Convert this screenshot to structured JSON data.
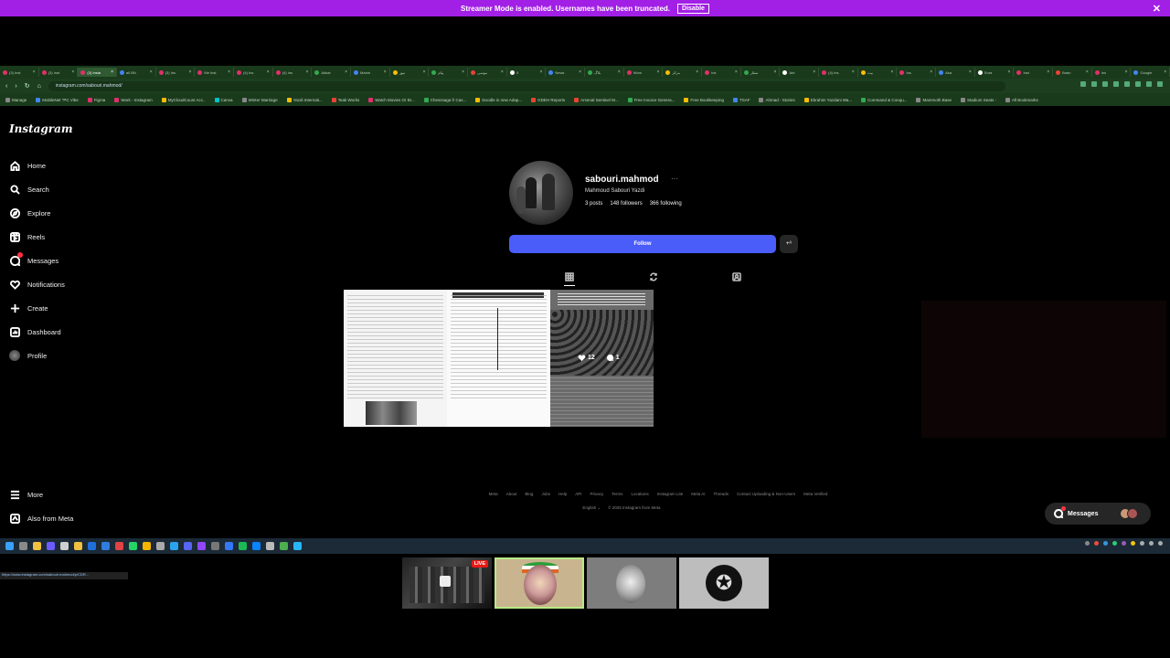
{
  "streamer": {
    "message": "Streamer Mode is enabled. Usernames have been truncated.",
    "disable_label": "Disable",
    "close_glyph": "✕"
  },
  "browser": {
    "tabs": [
      "(3) Inst",
      "(3) Inst",
      "(3) Insta",
      "all BN",
      "(3) Ins",
      "Me Inst",
      "(4) Ins",
      "(4) Ins",
      "Akbar",
      "Mahm",
      "نیوز",
      "پیام",
      "موسی",
      "X",
      "News",
      "بلاگ",
      "Wom",
      "مرکز",
      "Ins",
      "سقار",
      "Ant",
      "(4) Ins",
      "بیت",
      "Ins",
      "Aka",
      "Sora",
      "Inst",
      "Brain",
      "Ins",
      "Google"
    ],
    "url": "instagram.com/sabouri.mahmod/",
    "bookmarks": [
      "Manage",
      "MobileNet \"PC Vibe",
      "Figma",
      "Work - Instagram",
      "MyCloudCount Acc..",
      "Canva",
      "Winter Marriage",
      "Yazdi Internati...",
      "Teak Works",
      "Watch Movies Or Br...",
      "Chesssaga fr Cas...",
      "Doodle in new Adap...",
      "GDEH Reports",
      "Arsenal Sentinel M...",
      "Free Invoice Genera...",
      "Free Bookkeeping",
      "TSAF",
      "Ahmad - Stories",
      "Ebrahim Yazdani Wa...",
      "Command & Conqu...",
      "Mammoth Base",
      "Stadium Seats -",
      "All Bookmarks"
    ]
  },
  "instagram": {
    "logo": "Instagram",
    "nav": [
      {
        "label": "Home",
        "icon": "home-icon"
      },
      {
        "label": "Search",
        "icon": "search-icon"
      },
      {
        "label": "Explore",
        "icon": "compass-icon"
      },
      {
        "label": "Reels",
        "icon": "reels-icon"
      },
      {
        "label": "Messages",
        "icon": "messenger-icon"
      },
      {
        "label": "Notifications",
        "icon": "heart-icon"
      },
      {
        "label": "Create",
        "icon": "plus-icon"
      },
      {
        "label": "Dashboard",
        "icon": "dashboard-icon"
      },
      {
        "label": "Profile",
        "icon": "avatar-icon"
      }
    ],
    "more_label": "More",
    "also_meta_label": "Also from Meta",
    "profile": {
      "username": "sabouri.mahmod",
      "more_dots": "···",
      "full_name": "Mahmoud Sabouri Yazdi",
      "posts": "3 posts",
      "followers": "148 followers",
      "following": "366 following",
      "follow_label": "Follow",
      "suggest_label": "+ᴬ"
    },
    "posts": [
      {
        "likes": "",
        "comments": ""
      },
      {
        "likes": "",
        "comments": ""
      },
      {
        "likes": "12",
        "comments": "1"
      }
    ],
    "footer_links": [
      "Meta",
      "About",
      "Blog",
      "Jobs",
      "Help",
      "API",
      "Privacy",
      "Terms",
      "Locations",
      "Instagram Lite",
      "Meta AI",
      "Threads",
      "Contact Uploading & Non-Users",
      "Meta Verified"
    ],
    "language": "English",
    "copyright": "© 2025 Instagram from Meta",
    "messages_pill": "Messages",
    "status_url": "https://www.instagram.com/sabouri.mahmod/p/CDR...",
    "colors": {
      "follow": "#4a5df9",
      "badge": "#ff3040",
      "banner": "#a21fe6"
    }
  },
  "cams": {
    "live_label": "LIVE"
  }
}
